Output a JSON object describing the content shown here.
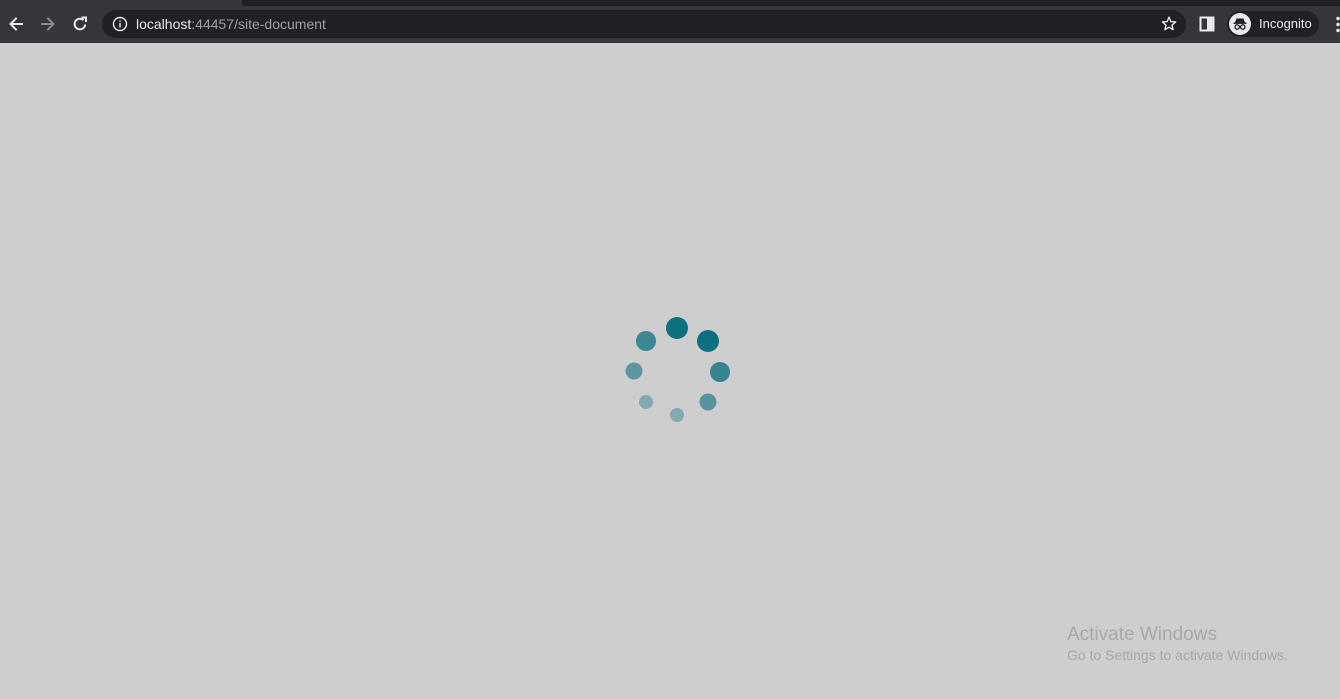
{
  "browser": {
    "url_host": "localhost",
    "url_rest": ":44457/site-document",
    "profile_label": "Incognito",
    "icons": {
      "back": "arrow-left-icon",
      "forward": "arrow-right-icon",
      "reload": "reload-icon",
      "site_info": "info-icon",
      "bookmark": "star-icon",
      "side_panel": "side-panel-icon",
      "profile": "incognito-icon",
      "menu": "kebab-menu-icon"
    }
  },
  "page": {
    "state": "loading",
    "spinner": {
      "icon": "loading-spinner",
      "color": "#0e6f80",
      "dot_count": 8
    }
  },
  "watermark": {
    "title": "Activate Windows",
    "subtitle": "Go to Settings to activate Windows."
  },
  "colors": {
    "page_background": "#cecece",
    "toolbar": "#35363a",
    "omnibox": "#202124"
  }
}
